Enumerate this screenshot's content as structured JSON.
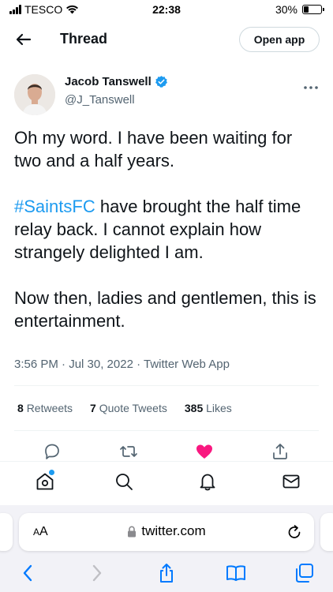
{
  "status_bar": {
    "carrier": "TESCO",
    "time": "22:38",
    "battery": "30%",
    "battery_level": 0.3
  },
  "header": {
    "title": "Thread",
    "open_app_label": "Open app"
  },
  "tweet": {
    "author_name": "Jacob Tanswell",
    "author_handle": "@J_Tanswell",
    "line1": "Oh my word. I have been waiting for two and a half years.",
    "hashtag": "#SaintsFC",
    "line2_rest": " have brought the half time relay back. I cannot explain how strangely delighted I am.",
    "line3": "Now then, ladies and gentlemen, this is entertainment.",
    "meta": "3:56 PM · Jul 30, 2022 · Twitter Web App"
  },
  "stats": {
    "retweets_count": "8",
    "retweets_label": "Retweets",
    "quotes_count": "7",
    "quotes_label": "Quote Tweets",
    "likes_count": "385",
    "likes_label": "Likes"
  },
  "safari": {
    "aa_label_big": "A",
    "aa_label_small": "A",
    "url": "twitter.com"
  },
  "colors": {
    "accent": "#1d9bf0",
    "like": "#f91880",
    "text_secondary": "#536471"
  },
  "icons": {
    "back": "arrow-left-icon",
    "verified": "verified-badge-icon",
    "more": "more-horizontal-icon",
    "reply": "reply-icon",
    "retweet": "retweet-icon",
    "like": "heart-filled-icon",
    "share": "share-icon",
    "home": "home-icon",
    "search": "search-icon",
    "notifications": "bell-icon",
    "messages": "mail-icon",
    "lock": "lock-icon",
    "reload": "reload-icon",
    "safari_back": "chevron-left-icon",
    "safari_forward": "chevron-right-icon",
    "safari_share": "share-icon",
    "bookmarks": "book-icon",
    "tabs": "tabs-icon"
  }
}
